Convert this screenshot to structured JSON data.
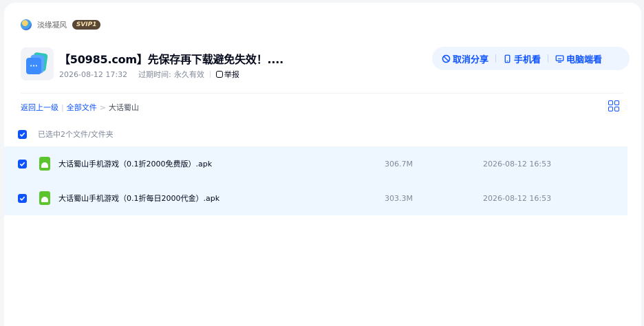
{
  "user": {
    "name": "淡缘凝风",
    "badge": "SVIP1"
  },
  "share": {
    "title": "【50985.com】先保存再下载避免失效！....",
    "created": "2026-08-12 17:32",
    "expire_label": "过期时间:",
    "expire_value": "永久有效",
    "report_label": "举报",
    "thumb_symbol": "···"
  },
  "actions": {
    "cancel_share": "取消分享",
    "mobile_view": "手机看",
    "pc_view": "电脑端看"
  },
  "breadcrumb": {
    "back": "返回上一级",
    "all_files": "全部文件",
    "separator": ">",
    "current": "大话蜀山"
  },
  "selection": {
    "summary": "已选中2个文件/文件夹"
  },
  "files": [
    {
      "name": "大话蜀山手机游戏（0.1折2000免费版）.apk",
      "size": "306.7M",
      "time": "2026-08-12 16:53",
      "checked": true
    },
    {
      "name": "大话蜀山手机游戏（0.1折每日2000代金）.apk",
      "size": "303.3M",
      "time": "2026-08-12 16:53",
      "checked": true
    }
  ],
  "colors": {
    "accent": "#0d53ff",
    "row_highlight": "#eef6ff",
    "apk_green": "#5cc52e"
  }
}
